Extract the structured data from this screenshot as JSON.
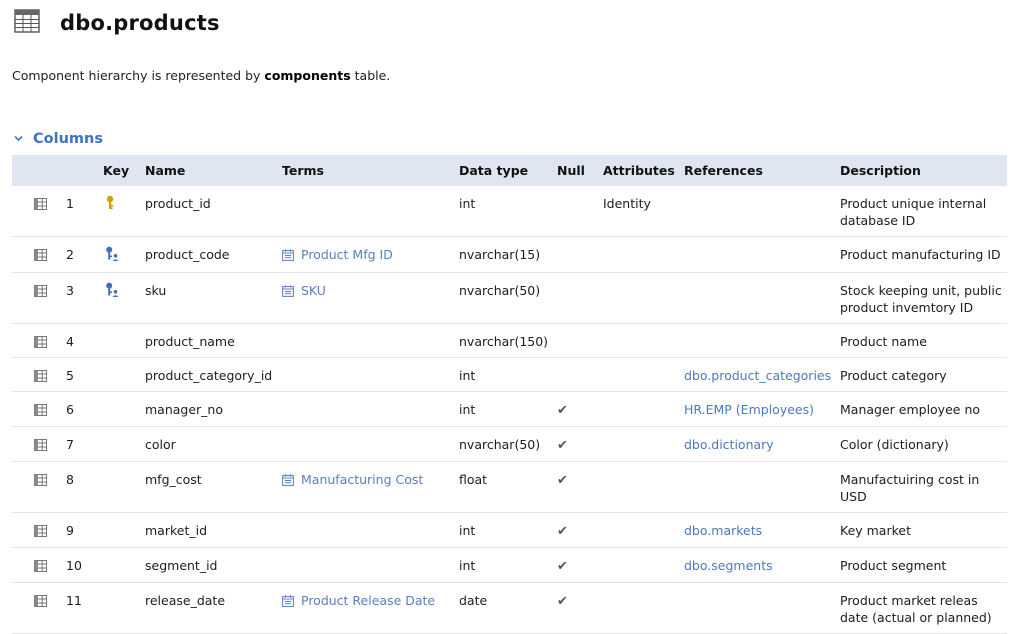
{
  "header": {
    "title": "dbo.products",
    "table_icon": "table-grid-icon"
  },
  "description": {
    "prefix": "Component hierarchy is represented by ",
    "bold": "components",
    "suffix": " table."
  },
  "section": {
    "title": "Columns",
    "chevron_icon": "chevron-down-icon"
  },
  "columns": {
    "headers": [
      "Key",
      "Name",
      "Terms",
      "Data type",
      "Null",
      "Attributes",
      "References",
      "Description"
    ],
    "rows": [
      {
        "num": "1",
        "key": "primary",
        "name": "product_id",
        "term": "",
        "type": "int",
        "null": false,
        "attr": "Identity",
        "ref": "",
        "desc": "Product unique internal database ID"
      },
      {
        "num": "2",
        "key": "unique",
        "name": "product_code",
        "term": "Product Mfg ID",
        "type": "nvarchar(15)",
        "null": false,
        "attr": "",
        "ref": "",
        "desc": "Product manufacturing ID"
      },
      {
        "num": "3",
        "key": "unique",
        "name": "sku",
        "term": "SKU",
        "type": "nvarchar(50)",
        "null": false,
        "attr": "",
        "ref": "",
        "desc": "Stock keeping unit, public product invemtory ID"
      },
      {
        "num": "4",
        "key": "",
        "name": "product_name",
        "term": "",
        "type": "nvarchar(150)",
        "null": false,
        "attr": "",
        "ref": "",
        "desc": "Product name"
      },
      {
        "num": "5",
        "key": "",
        "name": "product_category_id",
        "term": "",
        "type": "int",
        "null": false,
        "attr": "",
        "ref": "dbo.product_categories",
        "desc": "Product category"
      },
      {
        "num": "6",
        "key": "",
        "name": "manager_no",
        "term": "",
        "type": "int",
        "null": true,
        "attr": "",
        "ref": "HR.EMP (Employees)",
        "desc": "Manager employee no"
      },
      {
        "num": "7",
        "key": "",
        "name": "color",
        "term": "",
        "type": "nvarchar(50)",
        "null": true,
        "attr": "",
        "ref": "dbo.dictionary",
        "desc": "Color (dictionary)"
      },
      {
        "num": "8",
        "key": "",
        "name": "mfg_cost",
        "term": "Manufacturing Cost",
        "type": "float",
        "null": true,
        "attr": "",
        "ref": "",
        "desc": "Manufactuiring cost in USD"
      },
      {
        "num": "9",
        "key": "",
        "name": "market_id",
        "term": "",
        "type": "int",
        "null": true,
        "attr": "",
        "ref": "dbo.markets",
        "desc": "Key market"
      },
      {
        "num": "10",
        "key": "",
        "name": "segment_id",
        "term": "",
        "type": "int",
        "null": true,
        "attr": "",
        "ref": "dbo.segments",
        "desc": "Product segment"
      },
      {
        "num": "11",
        "key": "",
        "name": "release_date",
        "term": "Product Release Date",
        "type": "date",
        "null": true,
        "attr": "",
        "ref": "",
        "desc": "Product market releas date (actual or planned)"
      }
    ]
  },
  "glyphs": {
    "check": "✔"
  },
  "colors": {
    "header_bg": "#dfe6f2",
    "link": "#4d78c2",
    "section_title": "#3d72c4",
    "primary_key": "#c9a400",
    "unique_key": "#3f6fb5"
  }
}
